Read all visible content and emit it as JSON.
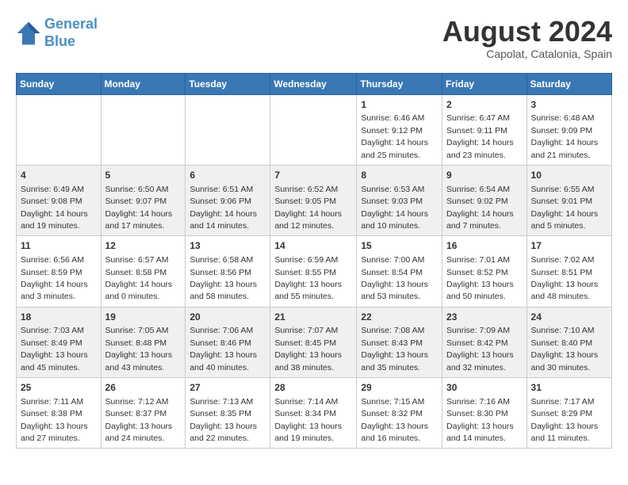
{
  "header": {
    "logo_line1": "General",
    "logo_line2": "Blue",
    "month_year": "August 2024",
    "location": "Capolat, Catalonia, Spain"
  },
  "weekdays": [
    "Sunday",
    "Monday",
    "Tuesday",
    "Wednesday",
    "Thursday",
    "Friday",
    "Saturday"
  ],
  "weeks": [
    [
      {
        "day": "",
        "info": ""
      },
      {
        "day": "",
        "info": ""
      },
      {
        "day": "",
        "info": ""
      },
      {
        "day": "",
        "info": ""
      },
      {
        "day": "1",
        "info": "Sunrise: 6:46 AM\nSunset: 9:12 PM\nDaylight: 14 hours and 25 minutes."
      },
      {
        "day": "2",
        "info": "Sunrise: 6:47 AM\nSunset: 9:11 PM\nDaylight: 14 hours and 23 minutes."
      },
      {
        "day": "3",
        "info": "Sunrise: 6:48 AM\nSunset: 9:09 PM\nDaylight: 14 hours and 21 minutes."
      }
    ],
    [
      {
        "day": "4",
        "info": "Sunrise: 6:49 AM\nSunset: 9:08 PM\nDaylight: 14 hours and 19 minutes."
      },
      {
        "day": "5",
        "info": "Sunrise: 6:50 AM\nSunset: 9:07 PM\nDaylight: 14 hours and 17 minutes."
      },
      {
        "day": "6",
        "info": "Sunrise: 6:51 AM\nSunset: 9:06 PM\nDaylight: 14 hours and 14 minutes."
      },
      {
        "day": "7",
        "info": "Sunrise: 6:52 AM\nSunset: 9:05 PM\nDaylight: 14 hours and 12 minutes."
      },
      {
        "day": "8",
        "info": "Sunrise: 6:53 AM\nSunset: 9:03 PM\nDaylight: 14 hours and 10 minutes."
      },
      {
        "day": "9",
        "info": "Sunrise: 6:54 AM\nSunset: 9:02 PM\nDaylight: 14 hours and 7 minutes."
      },
      {
        "day": "10",
        "info": "Sunrise: 6:55 AM\nSunset: 9:01 PM\nDaylight: 14 hours and 5 minutes."
      }
    ],
    [
      {
        "day": "11",
        "info": "Sunrise: 6:56 AM\nSunset: 8:59 PM\nDaylight: 14 hours and 3 minutes."
      },
      {
        "day": "12",
        "info": "Sunrise: 6:57 AM\nSunset: 8:58 PM\nDaylight: 14 hours and 0 minutes."
      },
      {
        "day": "13",
        "info": "Sunrise: 6:58 AM\nSunset: 8:56 PM\nDaylight: 13 hours and 58 minutes."
      },
      {
        "day": "14",
        "info": "Sunrise: 6:59 AM\nSunset: 8:55 PM\nDaylight: 13 hours and 55 minutes."
      },
      {
        "day": "15",
        "info": "Sunrise: 7:00 AM\nSunset: 8:54 PM\nDaylight: 13 hours and 53 minutes."
      },
      {
        "day": "16",
        "info": "Sunrise: 7:01 AM\nSunset: 8:52 PM\nDaylight: 13 hours and 50 minutes."
      },
      {
        "day": "17",
        "info": "Sunrise: 7:02 AM\nSunset: 8:51 PM\nDaylight: 13 hours and 48 minutes."
      }
    ],
    [
      {
        "day": "18",
        "info": "Sunrise: 7:03 AM\nSunset: 8:49 PM\nDaylight: 13 hours and 45 minutes."
      },
      {
        "day": "19",
        "info": "Sunrise: 7:05 AM\nSunset: 8:48 PM\nDaylight: 13 hours and 43 minutes."
      },
      {
        "day": "20",
        "info": "Sunrise: 7:06 AM\nSunset: 8:46 PM\nDaylight: 13 hours and 40 minutes."
      },
      {
        "day": "21",
        "info": "Sunrise: 7:07 AM\nSunset: 8:45 PM\nDaylight: 13 hours and 38 minutes."
      },
      {
        "day": "22",
        "info": "Sunrise: 7:08 AM\nSunset: 8:43 PM\nDaylight: 13 hours and 35 minutes."
      },
      {
        "day": "23",
        "info": "Sunrise: 7:09 AM\nSunset: 8:42 PM\nDaylight: 13 hours and 32 minutes."
      },
      {
        "day": "24",
        "info": "Sunrise: 7:10 AM\nSunset: 8:40 PM\nDaylight: 13 hours and 30 minutes."
      }
    ],
    [
      {
        "day": "25",
        "info": "Sunrise: 7:11 AM\nSunset: 8:38 PM\nDaylight: 13 hours and 27 minutes."
      },
      {
        "day": "26",
        "info": "Sunrise: 7:12 AM\nSunset: 8:37 PM\nDaylight: 13 hours and 24 minutes."
      },
      {
        "day": "27",
        "info": "Sunrise: 7:13 AM\nSunset: 8:35 PM\nDaylight: 13 hours and 22 minutes."
      },
      {
        "day": "28",
        "info": "Sunrise: 7:14 AM\nSunset: 8:34 PM\nDaylight: 13 hours and 19 minutes."
      },
      {
        "day": "29",
        "info": "Sunrise: 7:15 AM\nSunset: 8:32 PM\nDaylight: 13 hours and 16 minutes."
      },
      {
        "day": "30",
        "info": "Sunrise: 7:16 AM\nSunset: 8:30 PM\nDaylight: 13 hours and 14 minutes."
      },
      {
        "day": "31",
        "info": "Sunrise: 7:17 AM\nSunset: 8:29 PM\nDaylight: 13 hours and 11 minutes."
      }
    ]
  ]
}
